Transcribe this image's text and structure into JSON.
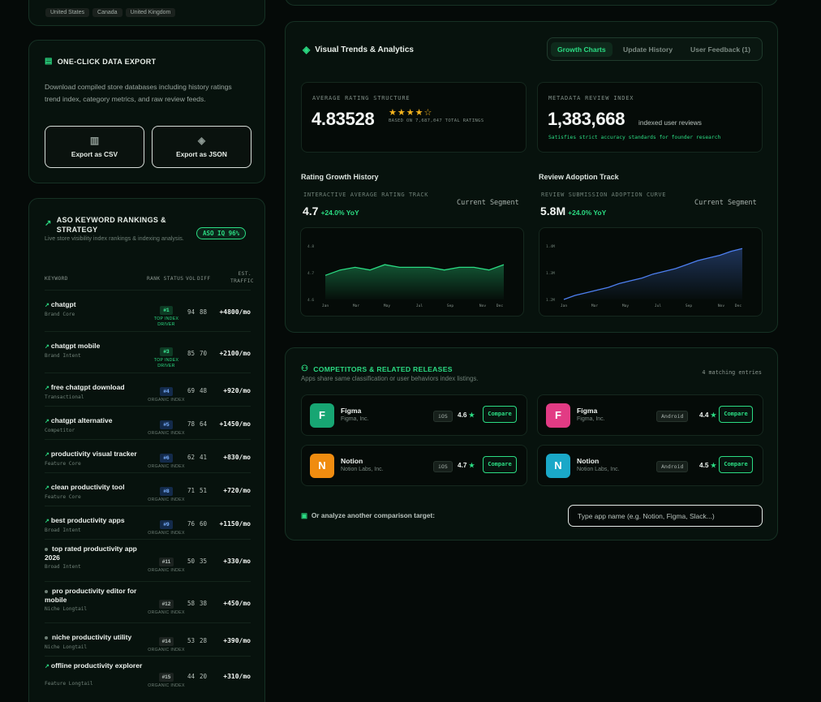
{
  "top": {
    "tags": [
      "United States",
      "Canada",
      "United Kingdom"
    ]
  },
  "export": {
    "title": "ONE-CLICK DATA EXPORT",
    "description": "Download compiled store databases including history ratings trend index, category metrics, and raw review feeds.",
    "csv_label": "Export as CSV",
    "json_label": "Export as JSON"
  },
  "keywords": {
    "title": "ASO KEYWORD RANKINGS & STRATEGY",
    "subtitle": "Live store visibility index rankings & indexing analysis.",
    "badge": "ASO IQ 96%",
    "headers": {
      "keyword": "KEYWORD",
      "rank": "RANK STATUS",
      "vol": "VOL",
      "diff": "DIFF",
      "traffic": "EST. TRAFFIC"
    },
    "rows": [
      {
        "name": "chatgpt",
        "intent": "Brand Core",
        "rank": "#1",
        "status": "TOP INDEX DRIVER",
        "vol": "94",
        "diff": "88",
        "traffic": "+4800/mo",
        "trend": "up",
        "top": true
      },
      {
        "name": "chatgpt mobile",
        "intent": "Brand Intent",
        "rank": "#3",
        "status": "TOP INDEX DRIVER",
        "vol": "85",
        "diff": "70",
        "traffic": "+2100/mo",
        "trend": "up",
        "top": true
      },
      {
        "name": "free chatgpt download",
        "intent": "Transactional",
        "rank": "#4",
        "status": "ORGANIC INDEX",
        "vol": "69",
        "diff": "48",
        "traffic": "+920/mo",
        "trend": "up",
        "top": false
      },
      {
        "name": "chatgpt alternative",
        "intent": "Competitor",
        "rank": "#5",
        "status": "ORGANIC INDEX",
        "vol": "78",
        "diff": "64",
        "traffic": "+1450/mo",
        "trend": "up",
        "top": false
      },
      {
        "name": "productivity visual tracker",
        "intent": "Feature Core",
        "rank": "#6",
        "status": "ORGANIC INDEX",
        "vol": "62",
        "diff": "41",
        "traffic": "+830/mo",
        "trend": "up",
        "top": false
      },
      {
        "name": "clean productivity tool",
        "intent": "Feature Core",
        "rank": "#8",
        "status": "ORGANIC INDEX",
        "vol": "71",
        "diff": "51",
        "traffic": "+720/mo",
        "trend": "up",
        "top": false
      },
      {
        "name": "best productivity apps",
        "intent": "Broad Intent",
        "rank": "#9",
        "status": "ORGANIC INDEX",
        "vol": "76",
        "diff": "60",
        "traffic": "+1150/mo",
        "trend": "up",
        "top": false
      },
      {
        "name": "top rated productivity app 2026",
        "intent": "Broad Intent",
        "rank": "#11",
        "status": "ORGANIC INDEX",
        "vol": "50",
        "diff": "35",
        "traffic": "+330/mo",
        "trend": "flat",
        "top": false
      },
      {
        "name": "pro productivity editor for mobile",
        "intent": "Niche Longtail",
        "rank": "#12",
        "status": "ORGANIC INDEX",
        "vol": "58",
        "diff": "38",
        "traffic": "+450/mo",
        "trend": "flat",
        "top": false
      },
      {
        "name": "niche productivity utility",
        "intent": "Niche Longtail",
        "rank": "#14",
        "status": "ORGANIC INDEX",
        "vol": "53",
        "diff": "28",
        "traffic": "+390/mo",
        "trend": "flat",
        "top": false
      },
      {
        "name": "offline productivity explorer",
        "intent": "Feature Longtail",
        "rank": "#15",
        "status": "ORGANIC INDEX",
        "vol": "44",
        "diff": "20",
        "traffic": "+310/mo",
        "trend": "up",
        "top": false
      }
    ]
  },
  "trends": {
    "title": "Visual Trends & Analytics",
    "tabs": [
      "Growth Charts",
      "Update History",
      "User Feedback (1)"
    ],
    "rating": {
      "label": "AVERAGE RATING STRUCTURE",
      "value": "4.83528",
      "stars": "★★★★☆",
      "based": "BASED ON 7,687,047 TOTAL RATINGS"
    },
    "reviews": {
      "label": "METADATA REVIEW INDEX",
      "value": "1,383,668",
      "unit": "indexed user reviews",
      "note": "Satisfies strict accuracy standards for founder research"
    },
    "left_chart": {
      "heading": "Rating Growth History",
      "sub": "INTERACTIVE AVERAGE RATING TRACK",
      "segment": "Current Segment",
      "value": "4.7",
      "yoy": "+24.0% YoY"
    },
    "right_chart": {
      "heading": "Review Adoption Track",
      "sub": "REVIEW SUBMISSION ADOPTION CURVE",
      "segment": "Current Segment",
      "value": "5.8M",
      "yoy": "+24.0% YoY"
    }
  },
  "chart_data": [
    {
      "type": "area",
      "x": [
        "Jan",
        "Mar",
        "May",
        "Jul",
        "Sep",
        "Nov",
        "Dec"
      ],
      "yticks": [
        "4.8",
        "4.7",
        "4.6"
      ],
      "ylim": [
        4.6,
        4.8
      ],
      "values": [
        4.69,
        4.71,
        4.72,
        4.71,
        4.73,
        4.72,
        4.72,
        4.72,
        4.71,
        4.72,
        4.72,
        4.71,
        4.73
      ],
      "color": "#2bdc83"
    },
    {
      "type": "area",
      "x": [
        "Jan",
        "Mar",
        "May",
        "Jul",
        "Sep",
        "Nov",
        "Dec"
      ],
      "yticks": [
        "1.4M",
        "1.3M",
        "1.2M"
      ],
      "ylim": [
        1.2,
        1.4
      ],
      "values": [
        1.2,
        1.215,
        1.225,
        1.235,
        1.245,
        1.26,
        1.27,
        1.28,
        1.295,
        1.305,
        1.315,
        1.33,
        1.345,
        1.355,
        1.365,
        1.38,
        1.39
      ],
      "color": "#4d7ff0"
    }
  ],
  "competitors": {
    "title": "COMPETITORS & RELATED RELEASES",
    "subtitle": "Apps share same classification or user behaviors index listings.",
    "count": "4 matching entries",
    "items": [
      {
        "initial": "F",
        "name": "Figma",
        "dev": "Figma, Inc.",
        "platform": "iOS",
        "rating": "4.6",
        "compare": "Compare",
        "color": "#17a673"
      },
      {
        "initial": "F",
        "name": "Figma",
        "dev": "Figma, Inc.",
        "platform": "Android",
        "rating": "4.4",
        "compare": "Compare",
        "color": "#e23b84"
      },
      {
        "initial": "N",
        "name": "Notion",
        "dev": "Notion Labs, Inc.",
        "platform": "iOS",
        "rating": "4.7",
        "compare": "Compare",
        "color": "#f08c10"
      },
      {
        "initial": "N",
        "name": "Notion",
        "dev": "Notion Labs, Inc.",
        "platform": "Android",
        "rating": "4.5",
        "compare": "Compare",
        "color": "#1aa8c8"
      }
    ],
    "analyze_label": "Or analyze another comparison target:",
    "placeholder": "Type app name (e.g. Notion, Figma, Slack...)"
  },
  "icons": {
    "export": "file-export-icon",
    "trend": "trend-up-icon",
    "layers": "layers-icon",
    "users": "users-icon",
    "folder": "folder-icon",
    "star": "star-icon"
  }
}
